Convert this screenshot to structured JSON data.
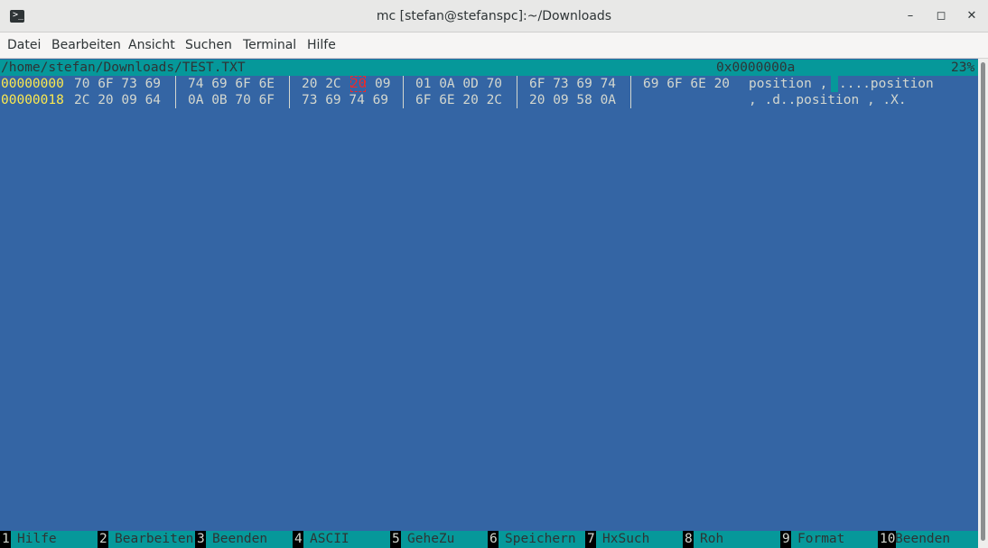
{
  "window": {
    "title": "mc [stefan@stefanspc]:~/Downloads",
    "icon": "terminal-icon",
    "minimize": "–",
    "maximize": "◻",
    "close": "✕"
  },
  "menu": [
    "Datei",
    "Bearbeiten",
    "Ansicht",
    "Suchen",
    "Terminal",
    "Hilfe"
  ],
  "viewer": {
    "path": "/home/stefan/Downloads/TEST.TXT",
    "offset": "0x0000000a",
    "percent": "23%",
    "rows": [
      {
        "address": "00000000",
        "groups": [
          "70 6F 73 69",
          "74 69 6F 6E",
          "20 2C",
          "20",
          "09",
          "01 0A 0D 70",
          "6F 73 69 74",
          "69 6F 6E 20"
        ],
        "ascii_a": "position , ",
        "ascii_b": "....position"
      },
      {
        "address": "00000018",
        "groups": [
          "2C 20 09 64",
          "0A 0B 70 6F",
          "73 69 74 69",
          "6F 6E 20 2C",
          "20 09 58 0A"
        ],
        "ascii": ", .d..position , .X."
      }
    ]
  },
  "fkeys": [
    {
      "num": "1",
      "label": "Hilfe"
    },
    {
      "num": "2",
      "label": "Bearbeiten"
    },
    {
      "num": "3",
      "label": "Beenden"
    },
    {
      "num": "4",
      "label": "ASCII"
    },
    {
      "num": "5",
      "label": "GeheZu"
    },
    {
      "num": "6",
      "label": "Speichern"
    },
    {
      "num": "7",
      "label": "HxSuch"
    },
    {
      "num": "8",
      "label": "Roh"
    },
    {
      "num": "9",
      "label": "Format"
    },
    {
      "num": "10",
      "label": "Beenden"
    }
  ],
  "colors": {
    "terminal_bg": "#3465a4",
    "status_bg": "#06989a",
    "address": "#fce94f",
    "cursor": "#ef2929"
  }
}
